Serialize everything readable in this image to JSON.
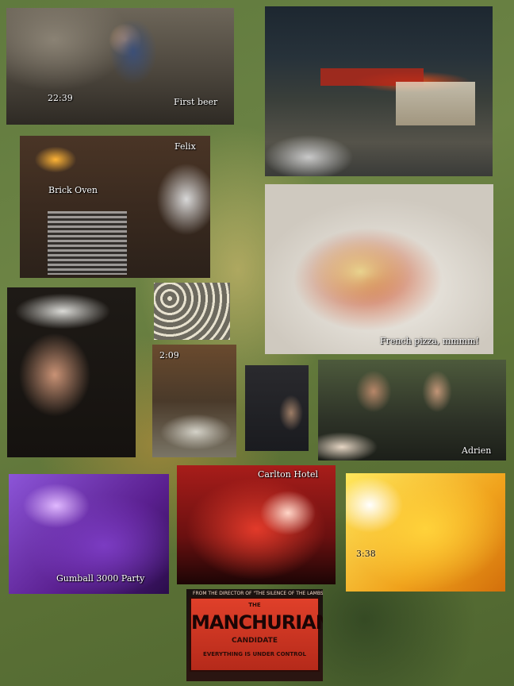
{
  "photos": {
    "first_beer": {
      "time": "22:39",
      "caption": "First beer"
    },
    "pizzeria": {},
    "oven": {
      "caption_cat": "Felix",
      "caption_oven": "Brick Oven"
    },
    "pizza": {
      "caption": "French pizza, mmmm!"
    },
    "selfie": {},
    "shots": {
      "time": "2:09"
    },
    "bar": {},
    "adrien": {
      "caption": "Adrien"
    },
    "gumball": {
      "caption": "Gumball 3000 Party"
    },
    "carlton": {
      "caption": "Carlton Hotel"
    },
    "yellow": {
      "time": "3:38"
    },
    "poster": {
      "top_line": "FROM THE DIRECTOR OF \"THE SILENCE OF THE LAMBS\"",
      "the": "THE",
      "title": "MANCHURIAN",
      "subtitle": "CANDIDATE",
      "bottom_line": "EVERYTHING IS UNDER CONTROL"
    }
  }
}
